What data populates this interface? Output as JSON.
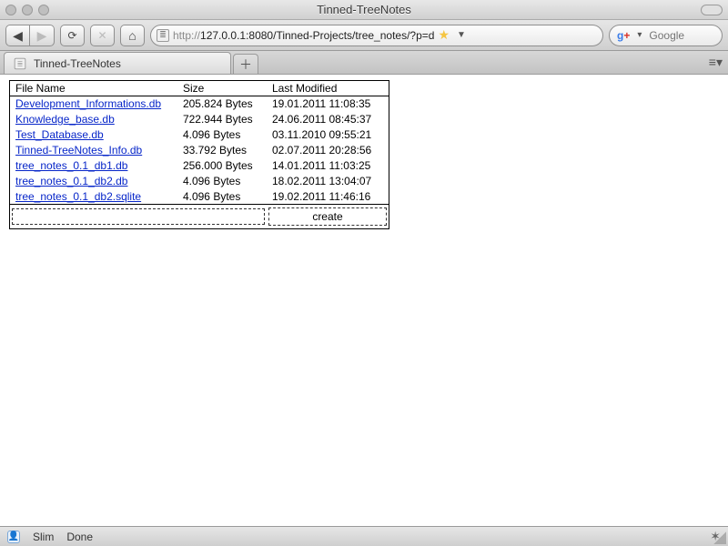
{
  "window": {
    "title": "Tinned-TreeNotes"
  },
  "toolbar": {
    "url_prefix": "http://",
    "url_rest": "127.0.0.1:8080/Tinned-Projects/tree_notes/?p=d",
    "search_placeholder": "Google"
  },
  "tab": {
    "title": "Tinned-TreeNotes"
  },
  "table": {
    "headers": {
      "name": "File Name",
      "size": "Size",
      "modified": "Last Modified"
    },
    "rows": [
      {
        "name": "Development_Informations.db",
        "size": "205.824 Bytes",
        "modified": "19.01.2011 11:08:35"
      },
      {
        "name": "Knowledge_base.db",
        "size": "722.944 Bytes",
        "modified": "24.06.2011 08:45:37"
      },
      {
        "name": "Test_Database.db",
        "size": "4.096 Bytes",
        "modified": "03.11.2010 09:55:21"
      },
      {
        "name": "Tinned-TreeNotes_Info.db",
        "size": "33.792 Bytes",
        "modified": "02.07.2011 20:28:56"
      },
      {
        "name": "tree_notes_0.1_db1.db",
        "size": "256.000 Bytes",
        "modified": "14.01.2011 11:03:25"
      },
      {
        "name": "tree_notes_0.1_db2.db",
        "size": "4.096 Bytes",
        "modified": "18.02.2011 13:04:07"
      },
      {
        "name": "tree_notes_0.1_db2.sqlite",
        "size": "4.096 Bytes",
        "modified": "19.02.2011 11:46:16"
      }
    ],
    "create_label": "create"
  },
  "status": {
    "user": "Slim",
    "state": "Done"
  }
}
